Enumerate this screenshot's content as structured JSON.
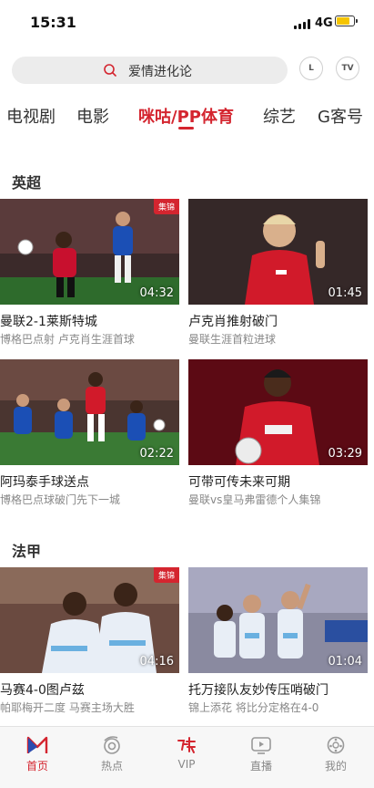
{
  "status_bar": {
    "time": "15:31",
    "network": "4G"
  },
  "search": {
    "query": "爱情进化论",
    "button_l": "L",
    "button_tv": "TV"
  },
  "tabs": [
    {
      "label": "电视剧",
      "active": false
    },
    {
      "label": "电影",
      "active": false
    },
    {
      "label": "咪咕/PP体育",
      "active": true
    },
    {
      "label": "综艺",
      "active": false
    },
    {
      "label": "G客号",
      "active": false
    }
  ],
  "sections": [
    {
      "title": "英超",
      "cards": [
        {
          "title": "曼联2-1莱斯特城",
          "subtitle": "博格巴点射 卢克肖生涯首球",
          "duration": "04:32",
          "badge": "集锦"
        },
        {
          "title": "卢克肖推射破门",
          "subtitle": "曼联生涯首粒进球",
          "duration": "01:45",
          "badge": ""
        },
        {
          "title": "阿玛泰手球送点",
          "subtitle": "博格巴点球破门先下一城",
          "duration": "02:22",
          "badge": ""
        },
        {
          "title": "可带可传未来可期",
          "subtitle": "曼联vs皇马弗雷德个人集锦",
          "duration": "03:29",
          "badge": ""
        }
      ]
    },
    {
      "title": "法甲",
      "cards": [
        {
          "title": "马赛4-0图卢兹",
          "subtitle": "帕耶梅开二度 马赛主场大胜",
          "duration": "04:16",
          "badge": "集锦"
        },
        {
          "title": "托万接队友妙传压哨破门",
          "subtitle": "锦上添花 将比分定格在4-0",
          "duration": "01:04",
          "badge": ""
        }
      ]
    }
  ],
  "bottom_nav": [
    {
      "label": "首页",
      "icon": "home-icon",
      "active": true
    },
    {
      "label": "热点",
      "icon": "hotspot-icon",
      "active": false
    },
    {
      "label": "VIP",
      "icon": "vip-icon",
      "active": false
    },
    {
      "label": "直播",
      "icon": "live-icon",
      "active": false
    },
    {
      "label": "我的",
      "icon": "profile-icon",
      "active": false
    }
  ],
  "colors": {
    "accent": "#d4252f",
    "battery": "#f5c400"
  },
  "battery_level": 0.8
}
